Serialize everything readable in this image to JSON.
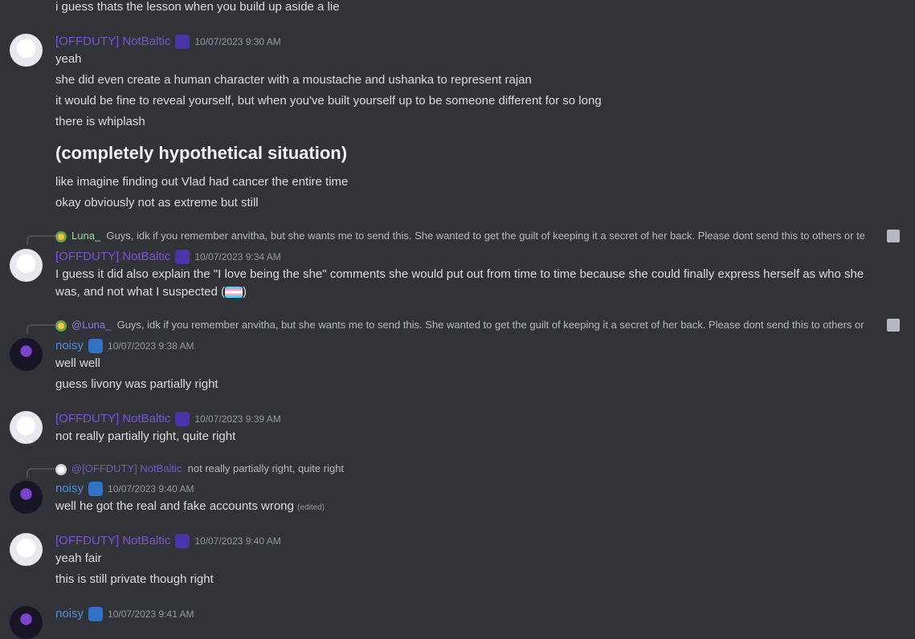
{
  "top_line": "i guess thats the lesson when you build up aside a lie",
  "users": {
    "baltic": "[OFFDUTY] NotBaltic",
    "noisy": "noisy",
    "luna": "Luna_"
  },
  "group1": {
    "timestamp": "10/07/2023 9:30 AM",
    "lines": [
      "yeah",
      "she did even create a human character with a moustache and ushanka to represent rajan",
      "it would be fine to reveal yourself, but when you've built yourself up to be someone different for so long",
      "there is whiplash"
    ],
    "heading": "(completely hypothetical situation)",
    "lines_after": [
      "like imagine finding out Vlad had cancer the entire time",
      "okay obviously not as extreme but still"
    ]
  },
  "group2": {
    "reply_text": "Guys, idk if you remember anvitha, but she wants me to send this. She wanted to get the guilt of keeping it a secret of her back. Please dont send this to others or te",
    "timestamp": "10/07/2023 9:34 AM",
    "text": "I guess it did also explain the \"I love being the she\" comments she would put out from time to time because she could finally express herself as who she was, and not what I suspected (",
    "text_end": ")"
  },
  "group3": {
    "reply_mention": "@Luna_",
    "reply_text": "Guys, idk if you remember anvitha, but she wants me to send this. She wanted to get the guilt of keeping it a secret of her back. Please dont send this to others or",
    "timestamp": "10/07/2023 9:38 AM",
    "lines": [
      "well well",
      "guess livony was partially right"
    ]
  },
  "group4": {
    "timestamp": "10/07/2023 9:39 AM",
    "text": "not really partially right, quite right"
  },
  "group5": {
    "reply_mention": "@[OFFDUTY] NotBaltic",
    "reply_text": "not really partially right, quite right",
    "timestamp": "10/07/2023 9:40 AM",
    "text": "well he got the real and fake accounts wrong",
    "edited": "(edited)"
  },
  "group6": {
    "timestamp": "10/07/2023 9:40 AM",
    "lines": [
      "yeah fair",
      "this is still private though right"
    ]
  },
  "group7": {
    "timestamp": "10/07/2023 9:41 AM"
  }
}
